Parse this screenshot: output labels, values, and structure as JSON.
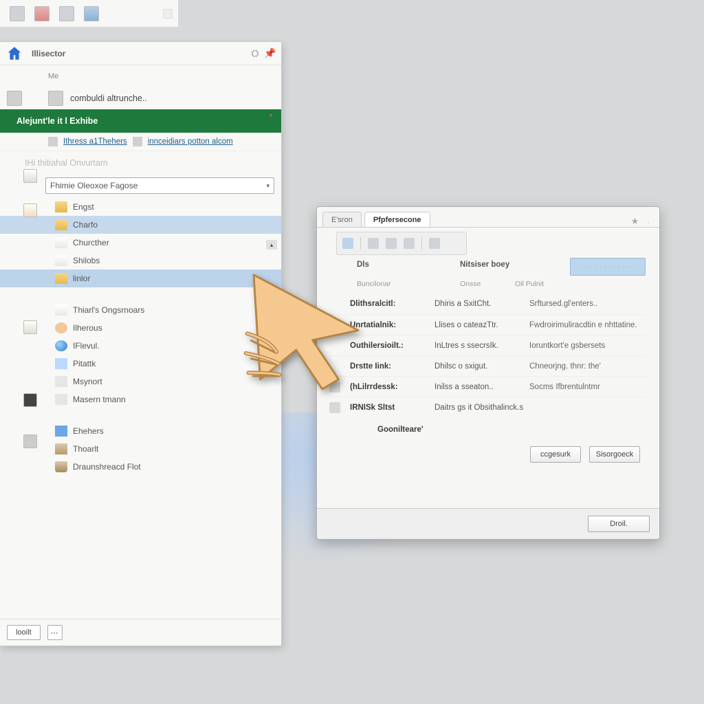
{
  "top_toolbar": {
    "icons": [
      "file",
      "app",
      "doc",
      "stack",
      "menu"
    ]
  },
  "left": {
    "header": {
      "title": "Illisector",
      "mini1": "⚙",
      "mini2": "✕"
    },
    "section_top_label": "Me",
    "section_top_sub": "combuldi altrunche..",
    "green_label": "Alejunt'le it l Exhibe",
    "link1": "Ithress a1Thehers",
    "link2": "innceidiars potton alcom",
    "disabled_row": "IHi thitiahal Onvurtarn",
    "combo": "Fhimie Oleoxoe Fagose",
    "tree": [
      {
        "label": "Engst",
        "sel": false
      },
      {
        "label": "Charfo",
        "sel": true
      },
      {
        "label": "Churcther",
        "sel": false
      },
      {
        "label": "Shilobs",
        "sel": false
      },
      {
        "label": "linlor",
        "sel": true
      },
      {
        "label": "Thiarl's Ongsrnoars",
        "sel": false
      },
      {
        "label": "Ilherous",
        "sel": false
      },
      {
        "label": "IFlevul.",
        "sel": false
      },
      {
        "label": "Pitattk",
        "sel": false
      },
      {
        "label": "Msynort",
        "sel": false
      },
      {
        "label": "Masern tmann",
        "sel": false
      },
      {
        "label": "Ehehers",
        "sel": false
      },
      {
        "label": "Thoarlt",
        "sel": false
      },
      {
        "label": "Draunshreacd Flot",
        "sel": false
      }
    ],
    "footer_btn": "looilt"
  },
  "dialog": {
    "tabs": [
      "E'sron",
      "Pfpfersecone"
    ],
    "head": {
      "col1": "Dls",
      "col2": "Nitsiser boey"
    },
    "subhead": {
      "c1": "Buncilonar",
      "c2": "Onsse",
      "c3": "Oil Pulnit"
    },
    "rows": [
      {
        "name": "Dlithsralcitl:",
        "type": "Dhiris a SxitCht.",
        "desc": "Srftursed.gl'enters.."
      },
      {
        "name": "Unrtatialnik:",
        "type": "Llises o cateazTtr.",
        "desc": "Fwdroirimuliracdtin e nhttatine."
      },
      {
        "name": "Outhilersioilt.:",
        "type": "InLtres s ssecrsIk.",
        "desc": "Ioruntkort'e gsbersets"
      },
      {
        "name": "Drstte Iink:",
        "type": "Dhilsc o sxigut.",
        "desc": "Chneorjng. thnr: the'"
      },
      {
        "name": "(hLilrrdessk:",
        "type": "Inilss a sseaton..",
        "desc": "Socms Ifbrentulntmr"
      },
      {
        "name": "IRNISk Sltst",
        "type": "Daitrs gs it Obsithalinck.s",
        "desc": ""
      }
    ],
    "footer_word": "Goonilteare'",
    "mid_btn1": "ccgesurk",
    "mid_btn2": "Sisorgoeck",
    "close_btn": "Droil."
  }
}
